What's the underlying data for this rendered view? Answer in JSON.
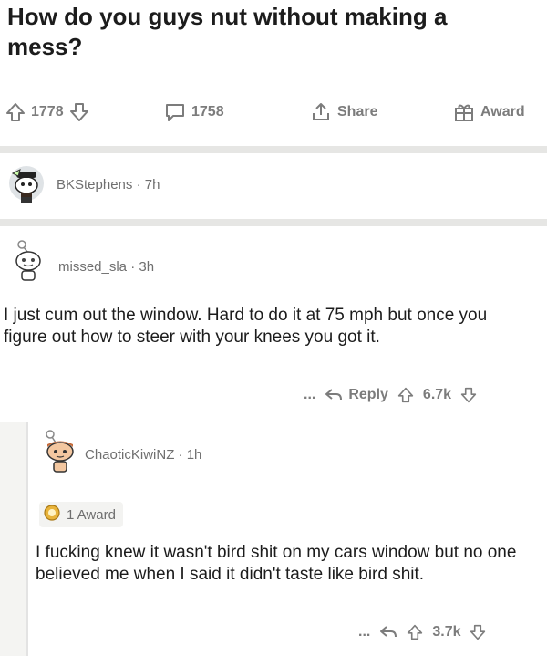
{
  "post": {
    "title": "How do you guys nut without making a mess?",
    "upvotes": "1778",
    "comments": "1758",
    "share_label": "Share",
    "award_label": "Award"
  },
  "comments": [
    {
      "username": "BKStephens",
      "age": "7h"
    },
    {
      "username": "missed_sla",
      "age": "3h",
      "body": "I just cum out the window. Hard to do it at 75 mph but once you figure out how to steer with your knees you got it.",
      "more": "...",
      "reply_label": "Reply",
      "score": "6.7k"
    }
  ],
  "reply": {
    "username": "ChaoticKiwiNZ",
    "age": "1h",
    "award_count": "1 Award",
    "body": "I fucking knew it wasn't bird shit on my cars window but no one believed me when I said it didn't taste like bird shit.",
    "more": "...",
    "score": "3.7k"
  },
  "meta_separator": "·",
  "icons": {
    "upvote": "upvote-arrow-icon",
    "downvote": "downvote-arrow-icon",
    "comment": "comment-bubble-icon",
    "share": "share-icon",
    "award": "gift-icon",
    "reply": "reply-arrow-icon"
  }
}
